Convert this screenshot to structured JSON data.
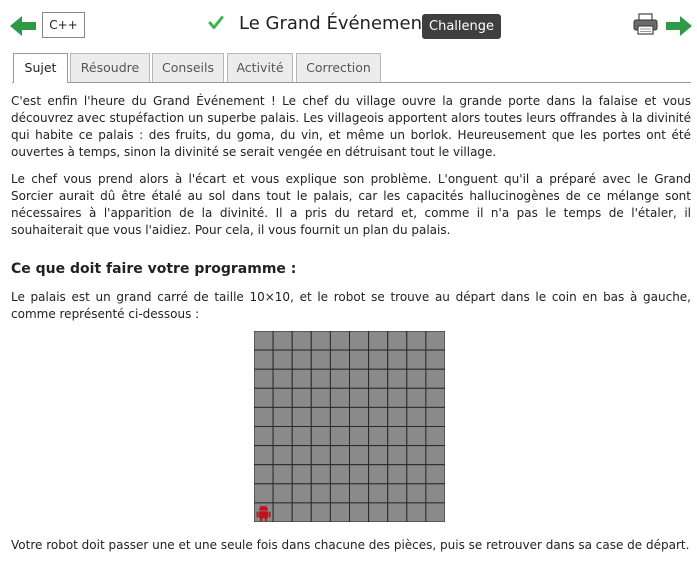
{
  "header": {
    "language": "C++",
    "title": "Le Grand Événement",
    "badge": "Challenge"
  },
  "icons": {
    "prev": "arrow-left-icon",
    "next": "arrow-right-icon",
    "status": "check-icon",
    "print": "printer-icon",
    "robot": "robot-icon"
  },
  "colors": {
    "nav_arrow": "#2e9a47",
    "check": "#3fb34f",
    "badge_bg": "#3f3f3f",
    "grid_cell": "#8a8a8a",
    "grid_line": "#2a2a2a",
    "robot": "#c0121b"
  },
  "tabs": [
    {
      "label": "Sujet",
      "active": true
    },
    {
      "label": "Résoudre",
      "active": false
    },
    {
      "label": "Conseils",
      "active": false
    },
    {
      "label": "Activité",
      "active": false
    },
    {
      "label": "Correction",
      "active": false
    }
  ],
  "content": {
    "p1": "C'est enfin l'heure du Grand Événement ! Le chef du village ouvre la grande porte dans la falaise et vous découvrez avec stupéfaction un superbe palais. Les villageois apportent alors toutes leurs offrandes à la divinité qui habite ce palais : des fruits, du goma, du vin, et même un borlok. Heureusement que les portes ont été ouvertes à temps, sinon la divinité se serait vengée en détruisant tout le village.",
    "p2": "Le chef vous prend alors à l'écart et vous explique son problème. L'onguent qu'il a préparé avec le Grand Sorcier aurait dû être étalé au sol dans tout le palais, car les capacités hallucinogènes de ce mélange sont nécessaires à l'apparition de la divinité. Il a pris du retard et, comme il n'a pas le temps de l'étaler, il souhaiterait que vous l'aidiez. Pour cela, il vous fournit un plan du palais.",
    "heading": "Ce que doit faire votre programme :",
    "p3": "Le palais est un grand carré de taille 10×10, et le robot se trouve au départ dans le coin en bas à gauche, comme représenté ci-dessous :",
    "p4": "Votre robot doit passer une et une seule fois dans chacune des pièces, puis se retrouver dans sa case de départ."
  },
  "grid": {
    "rows": 10,
    "cols": 10,
    "robot_row": 9,
    "robot_col": 0
  }
}
